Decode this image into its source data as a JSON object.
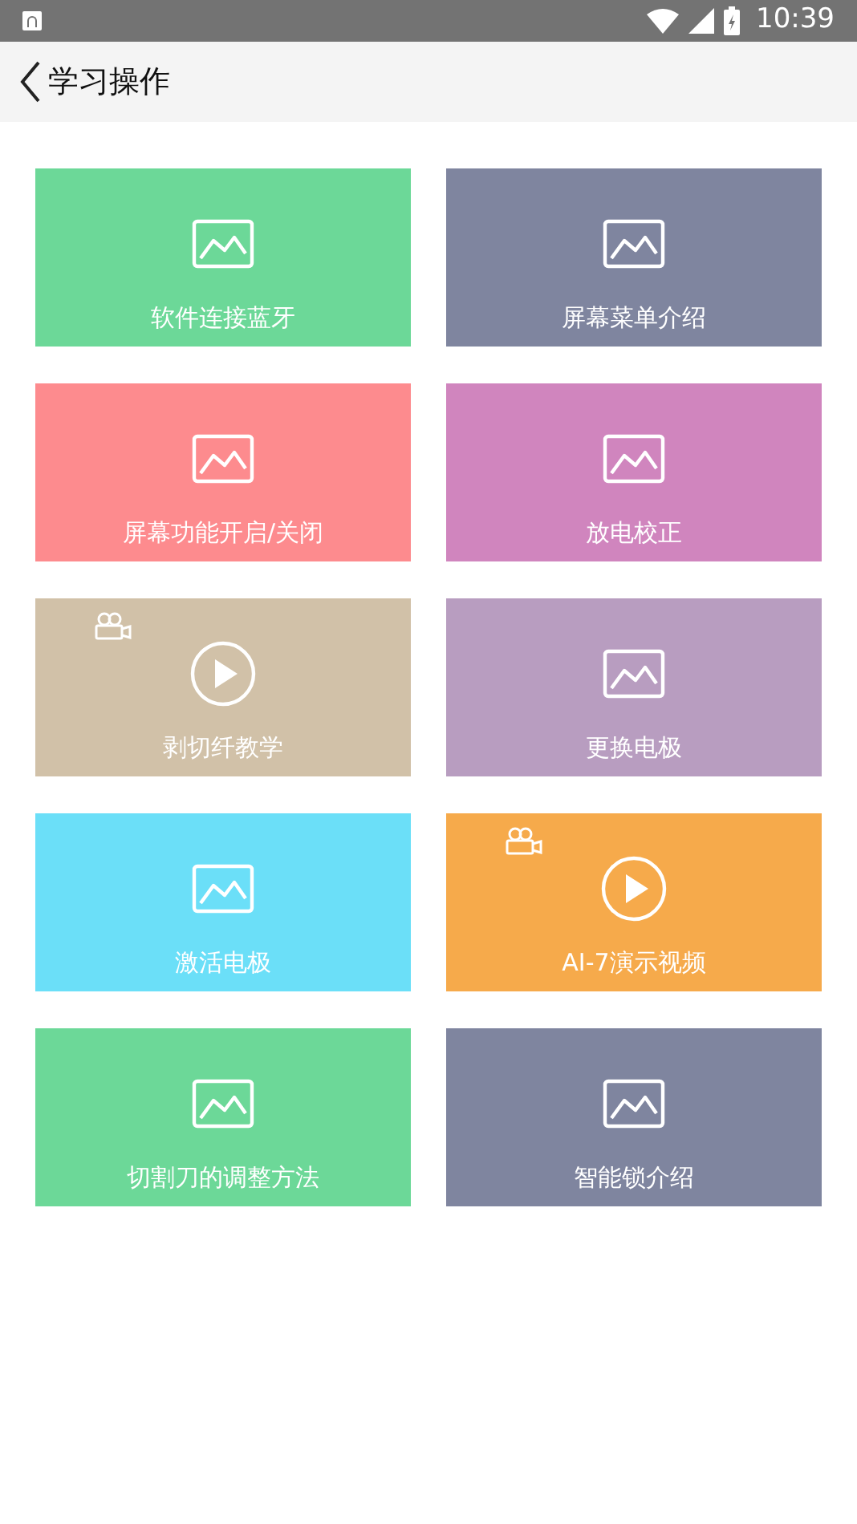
{
  "status_bar": {
    "time": "10:39"
  },
  "header": {
    "title": "学习操作"
  },
  "tiles": [
    {
      "label": "软件连接蓝牙",
      "kind": "image",
      "color": "#6cd898"
    },
    {
      "label": "屏幕菜单介绍",
      "kind": "image",
      "color": "#7f859f"
    },
    {
      "label": "屏幕功能开启/关闭",
      "kind": "image",
      "color": "#fd8b8e"
    },
    {
      "label": "放电校正",
      "kind": "image",
      "color": "#d085be"
    },
    {
      "label": "剥切纤教学",
      "kind": "video",
      "color": "#d1c1a8"
    },
    {
      "label": "更换电极",
      "kind": "image",
      "color": "#b89dc0"
    },
    {
      "label": "激活电极",
      "kind": "image",
      "color": "#6bdff8"
    },
    {
      "label": "AI-7演示视频",
      "kind": "video",
      "color": "#f6aa4b"
    },
    {
      "label": "切割刀的调整方法",
      "kind": "image",
      "color": "#6cd898"
    },
    {
      "label": "智能锁介绍",
      "kind": "image",
      "color": "#7f859f"
    }
  ]
}
